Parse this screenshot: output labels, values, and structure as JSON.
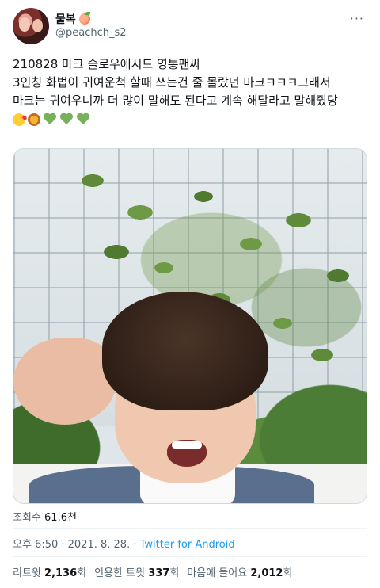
{
  "header": {
    "display_name": "물복",
    "display_name_emoji": "peach-emoji",
    "handle": "@peachch_s2",
    "more_label": "···"
  },
  "tweet": {
    "lines": [
      "210828 마크 슬로우애시드 영통팬싸",
      "3인칭 화법이 귀여운척 할때 쓰는건 줄 몰랐던 마크ㅋㅋㅋ그래서",
      "마크는 귀여우니까 더 많이 말해도 된다고 계속 해달라고 말해줬당"
    ],
    "emojis": [
      "kissing-face-emoji",
      "lion-emoji",
      "green-heart-emoji",
      "green-heart-emoji",
      "green-heart-emoji"
    ]
  },
  "media": {
    "type": "photo",
    "icon": "video-call-photo"
  },
  "views": {
    "label": "조회수",
    "value": "61.6천"
  },
  "meta": {
    "time": "오후 6:50",
    "sep1": " · ",
    "date": "2021. 8. 28.",
    "sep2": " · ",
    "source": "Twitter for Android"
  },
  "stats": {
    "retweets_label": "리트윗",
    "retweets_value": "2,136",
    "retweets_unit": "회",
    "quotes_label": "인용한 트윗",
    "quotes_value": "337",
    "quotes_unit": "회",
    "likes_label": "마음에 들어요",
    "likes_value": "2,012",
    "likes_unit": "회"
  }
}
